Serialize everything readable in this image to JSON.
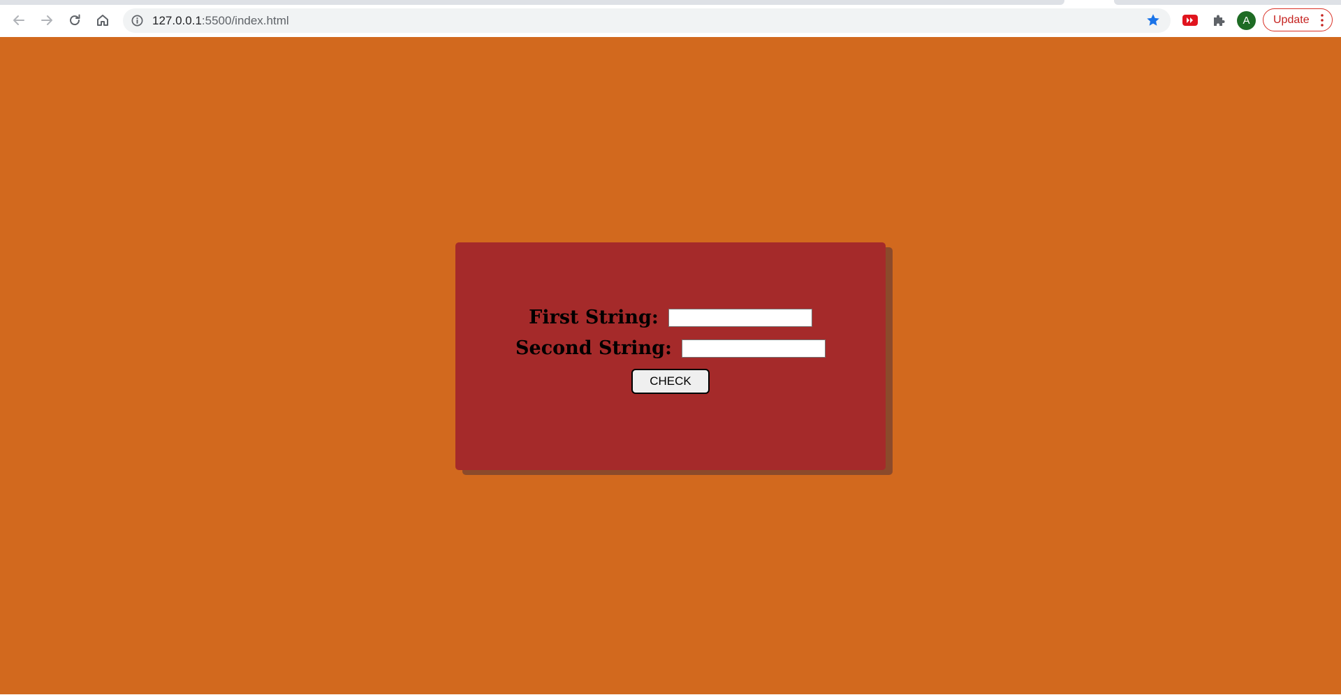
{
  "browser": {
    "url_host": "127.0.0.1",
    "url_path": ":5500/index.html",
    "profile_initial": "A",
    "update_label": "Update",
    "icons": {
      "back": "arrow-left-icon",
      "forward": "arrow-right-icon",
      "reload": "reload-icon",
      "home": "home-icon",
      "site_info": "info-icon",
      "bookmark": "star-icon",
      "extension_video": "video-extension-icon",
      "extensions": "puzzle-icon",
      "menu": "kebab-icon"
    },
    "colors": {
      "star": "#1a73e8",
      "update": "#c5221f",
      "avatar": "#1e6b24"
    }
  },
  "page": {
    "background_color": "#d2691e",
    "card_color": "#a52a2a",
    "form": {
      "first_label": "First String:",
      "first_value": "",
      "second_label": "Second String:",
      "second_value": "",
      "check_label": "CHECK"
    }
  }
}
